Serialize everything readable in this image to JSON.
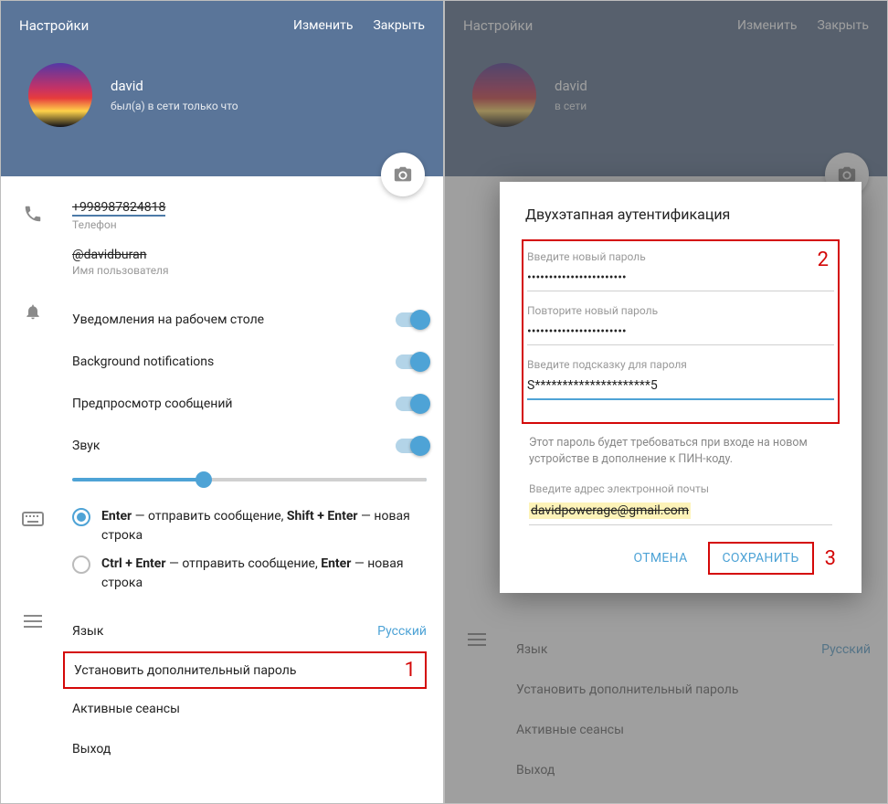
{
  "left": {
    "header": {
      "title": "Настройки",
      "edit": "Изменить",
      "close": "Закрыть",
      "name": "david",
      "status": "был(а) в сети только что"
    },
    "phone": {
      "value": "+998987824818",
      "label": "Телефон"
    },
    "username": {
      "value": "@davidburan",
      "label": "Имя пользователя"
    },
    "notif": {
      "desktop": "Уведомления на рабочем столе",
      "bg": "Background notifications",
      "preview": "Предпросмотр сообщений",
      "sound": "Звук"
    },
    "send": {
      "opt1a": "Enter",
      "opt1b": " — отправить сообщение, ",
      "opt1c": "Shift + Enter",
      "opt1d": " — новая строка",
      "opt2a": "Ctrl + Enter",
      "opt2b": " — отправить сообщение, ",
      "opt2c": "Enter",
      "opt2d": " — новая строка"
    },
    "menu": {
      "lang": "Язык",
      "lang_val": "Русский",
      "setpw": "Установить дополнительный пароль",
      "sessions": "Активные сеансы",
      "logout": "Выход"
    },
    "marker1": "1"
  },
  "right": {
    "header": {
      "title": "Настройки",
      "edit": "Изменить",
      "close": "Закрыть",
      "name": "david",
      "status": "в сети"
    },
    "menu": {
      "lang": "Язык",
      "lang_val": "Русский",
      "setpw": "Установить дополнительный пароль",
      "sessions": "Активные сеансы",
      "logout": "Выход"
    }
  },
  "modal": {
    "title": "Двухэтапная аутентификация",
    "pw1_lbl": "Введите новый пароль",
    "pw1_val": "•••••••••••••••••••••••",
    "pw2_lbl": "Повторите новый пароль",
    "pw2_val": "•••••••••••••••••••••••",
    "hint_lbl": "Введите подсказку для пароля",
    "hint_val": "S*********************5",
    "desc": "Этот пароль будет требоваться при входе на новом устройстве в дополнение к ПИН-коду.",
    "email_lbl": "Введите адрес электронной почты",
    "email_val": "davidpowerage@gmail.com",
    "cancel": "ОТМЕНА",
    "save": "СОХРАНИТЬ",
    "marker2": "2",
    "marker3": "3"
  }
}
